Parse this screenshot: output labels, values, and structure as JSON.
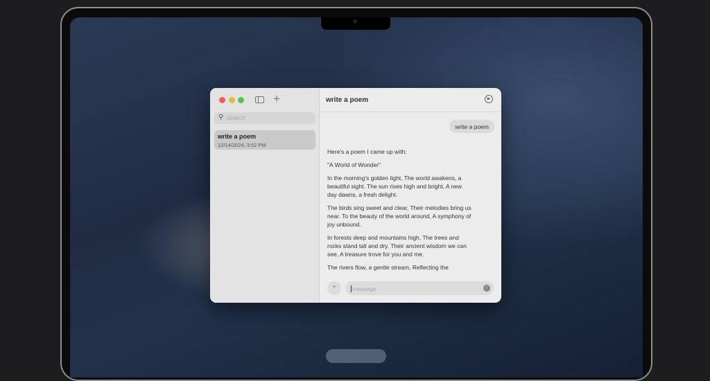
{
  "window": {
    "title": "write a poem",
    "colors": {
      "close": "#ec5f57",
      "minimize": "#e3b93c",
      "zoom": "#5cc245"
    }
  },
  "sidebar": {
    "search_placeholder": "search",
    "chats": [
      {
        "title": "write a poem",
        "timestamp": "12/14/2024, 3:52 PM"
      }
    ]
  },
  "chat": {
    "user_message": "write a poem",
    "reply": [
      "Here's a poem I came up with:",
      "\"A World of Wonder\"",
      "In the morning's golden light, The world awakens, a beautiful sight. The sun rises high and bright, A new day dawns, a fresh delight.",
      "The birds sing sweet and clear, Their melodies bring us near. To the beauty of the world around, A symphony of joy unbound.",
      "In forests deep and mountains high, The trees and rocks stand tall and dry. Their ancient wisdom we can see, A treasure trove for you and me.",
      "The rivers flow, a gentle stream, Reflecting the"
    ],
    "input_placeholder": "message"
  }
}
